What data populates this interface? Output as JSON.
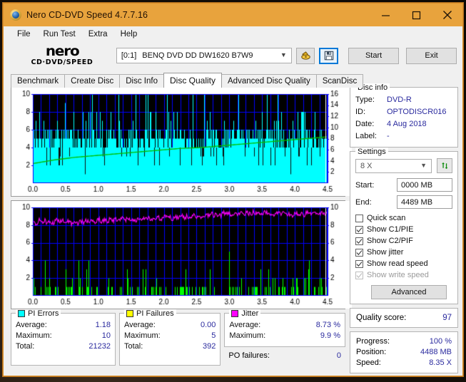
{
  "window": {
    "title": "Nero CD-DVD Speed 4.7.7.16",
    "icon": "nero-disc-icon",
    "minimize": "minimize-icon",
    "maximize": "maximize-icon",
    "close": "close-icon",
    "titlebar_color": "#e8a33d"
  },
  "menu": [
    "File",
    "Run Test",
    "Extra",
    "Help"
  ],
  "logo": {
    "line1": "nero",
    "line2": "CD·DVD∕SPEED"
  },
  "toolbar": {
    "drive_id": "[0:1]",
    "drive_name": "BENQ DVD DD DW1620 B7W9",
    "eject_icon": "eject-disc-icon",
    "save_icon": "save-floppy-icon",
    "start_label": "Start",
    "exit_label": "Exit"
  },
  "tabs": [
    {
      "label": "Benchmark",
      "active": false
    },
    {
      "label": "Create Disc",
      "active": false
    },
    {
      "label": "Disc Info",
      "active": false
    },
    {
      "label": "Disc Quality",
      "active": true
    },
    {
      "label": "Advanced Disc Quality",
      "active": false
    },
    {
      "label": "ScanDisc",
      "active": false
    }
  ],
  "disc_info": {
    "legend": "Disc info",
    "rows": [
      {
        "key": "Type:",
        "value": "DVD-R"
      },
      {
        "key": "ID:",
        "value": "OPTODISCR016"
      },
      {
        "key": "Date:",
        "value": "4 Aug 2018"
      },
      {
        "key": "Label:",
        "value": "-"
      }
    ]
  },
  "settings": {
    "legend": "Settings",
    "speed": "8 X",
    "refresh_icon": "refresh-arrows-icon",
    "start_label": "Start:",
    "start_value": "0000 MB",
    "end_label": "End:",
    "end_value": "4489 MB",
    "checkboxes": [
      {
        "label": "Quick scan",
        "checked": false,
        "disabled": false
      },
      {
        "label": "Show C1/PIE",
        "checked": true,
        "disabled": false
      },
      {
        "label": "Show C2/PIF",
        "checked": true,
        "disabled": false
      },
      {
        "label": "Show jitter",
        "checked": true,
        "disabled": false
      },
      {
        "label": "Show read speed",
        "checked": true,
        "disabled": false
      },
      {
        "label": "Show write speed",
        "checked": true,
        "disabled": true
      }
    ],
    "advanced_label": "Advanced"
  },
  "quality": {
    "label": "Quality score:",
    "value": "97"
  },
  "progress": {
    "rows": [
      {
        "key": "Progress:",
        "value": "100 %"
      },
      {
        "key": "Position:",
        "value": "4488 MB"
      },
      {
        "key": "Speed:",
        "value": "8.35 X"
      }
    ]
  },
  "stats": {
    "pi_errors": {
      "legend": "PI Errors",
      "swatch": "#00ffff",
      "rows": [
        {
          "key": "Average:",
          "value": "1.18"
        },
        {
          "key": "Maximum:",
          "value": "10"
        },
        {
          "key": "Total:",
          "value": "21232"
        }
      ]
    },
    "pi_failures": {
      "legend": "PI Failures",
      "swatch": "#ffff00",
      "rows": [
        {
          "key": "Average:",
          "value": "0.00"
        },
        {
          "key": "Maximum:",
          "value": "5"
        },
        {
          "key": "Total:",
          "value": "392"
        }
      ]
    },
    "jitter": {
      "legend": "Jitter",
      "swatch": "#ff00ff",
      "rows": [
        {
          "key": "Average:",
          "value": "8.73 %"
        },
        {
          "key": "Maximum:",
          "value": "9.9 %"
        }
      ],
      "po_key": "PO failures:",
      "po_value": "0"
    }
  },
  "chart_data": [
    {
      "type": "area",
      "name": "pie-read-speed-graph",
      "title": "PI Errors / Read speed",
      "xlabel": "",
      "ylabel": "",
      "xlim": [
        0.0,
        4.5
      ],
      "ylim": [
        0,
        10
      ],
      "y2lim": [
        0,
        16
      ],
      "grid": true,
      "background": "#000000",
      "gridcolor": "#0000ff",
      "xticks": [
        "0.0",
        "0.5",
        "1.0",
        "1.5",
        "2.0",
        "2.5",
        "3.0",
        "3.5",
        "4.0",
        "4.5"
      ],
      "yticks": [
        "2",
        "4",
        "6",
        "8",
        "10"
      ],
      "y2ticks": [
        "2",
        "4",
        "6",
        "8",
        "10",
        "12",
        "14",
        "16"
      ],
      "series": [
        {
          "name": "PI Errors",
          "color": "#00ffff",
          "style": "area-spikes",
          "baseline": 4,
          "values": [
            8,
            6,
            5,
            4,
            6,
            4,
            5,
            7,
            4,
            6,
            5,
            4,
            8,
            4,
            5,
            6,
            4,
            5,
            4,
            6,
            7,
            5,
            4,
            6,
            5,
            4,
            10,
            6,
            5,
            4,
            5,
            6,
            4,
            5,
            7,
            4,
            6,
            5,
            4,
            5,
            6,
            4,
            8,
            5,
            4,
            6,
            5,
            7,
            4,
            5,
            6,
            4,
            5,
            4,
            6,
            5,
            4,
            5,
            6,
            4,
            8,
            5,
            4,
            6,
            7,
            4,
            5,
            6,
            4,
            5,
            4,
            6,
            5,
            4,
            5,
            6,
            4,
            7,
            5,
            4,
            6,
            5,
            4,
            5,
            6,
            4,
            5,
            4,
            6,
            5,
            4,
            5,
            6,
            4,
            8,
            5,
            4,
            6,
            5,
            4,
            7,
            5,
            4,
            6,
            5,
            4,
            5,
            6,
            4,
            5,
            4,
            6,
            5,
            4,
            9,
            6,
            5,
            4,
            5,
            6,
            4,
            5,
            7,
            4,
            6,
            5,
            4,
            5,
            6,
            4,
            5,
            4,
            6,
            7,
            5,
            4,
            6,
            5,
            4,
            5,
            6,
            4,
            5,
            7,
            4,
            6,
            5,
            4,
            5,
            6,
            5,
            4,
            6,
            5,
            4,
            5,
            6,
            4,
            7,
            5,
            4,
            6,
            5,
            4,
            5,
            6,
            5,
            4,
            6,
            5,
            4,
            6,
            5,
            4,
            5,
            6,
            5,
            4,
            6,
            7,
            5,
            4,
            6,
            5,
            4,
            5
          ]
        },
        {
          "name": "Read speed",
          "color": "#00c000",
          "style": "line",
          "axis": "y2",
          "start_value": 3.5,
          "end_value": 8.35,
          "values_left_scale": [
            2.2,
            2.6,
            2.9,
            3.1,
            3.3,
            3.5,
            3.7,
            3.9,
            4.0,
            4.2,
            4.4,
            4.6,
            4.8,
            5.0,
            5.2
          ]
        }
      ]
    },
    {
      "type": "line",
      "name": "pif-jitter-graph",
      "title": "PI Failures / Jitter",
      "xlabel": "",
      "ylabel": "",
      "xlim": [
        0.0,
        4.5
      ],
      "ylim": [
        0,
        10
      ],
      "y2lim": [
        0,
        10
      ],
      "grid": true,
      "background": "#000000",
      "gridcolor": "#0000ff",
      "xticks": [
        "0.0",
        "0.5",
        "1.0",
        "1.5",
        "2.0",
        "2.5",
        "3.0",
        "3.5",
        "4.0",
        "4.5"
      ],
      "yticks": [
        "2",
        "4",
        "6",
        "8",
        "10"
      ],
      "y2ticks": [
        "2",
        "4",
        "6",
        "8",
        "10"
      ],
      "series": [
        {
          "name": "Jitter",
          "color": "#ff00ff",
          "style": "line",
          "range": [
            8.0,
            9.9
          ],
          "values": [
            8.3,
            8.1,
            8.6,
            8.3,
            8.5,
            8.2,
            8.4,
            8.2,
            8.6,
            8.3,
            8.5,
            8.2,
            8.4,
            8.1,
            8.3,
            8.2,
            8.5,
            8.3,
            8.6,
            8.4,
            8.5,
            8.3,
            8.7,
            8.4,
            8.6,
            8.4,
            8.7,
            8.5,
            8.6,
            8.4,
            8.7,
            8.5,
            8.8,
            8.6,
            8.7,
            8.5,
            8.8,
            8.6,
            8.9,
            8.7,
            8.8,
            8.6,
            8.9,
            8.7,
            9.0,
            8.8,
            8.9,
            8.7,
            9.0,
            8.8,
            9.1,
            8.9,
            9.0,
            8.8,
            9.2,
            9.0,
            9.1,
            8.9,
            9.2,
            9.0,
            9.3,
            9.1,
            9.2,
            9.0,
            9.4,
            9.2,
            9.3,
            9.1,
            9.4,
            9.2,
            9.5,
            9.3,
            9.4,
            9.2,
            9.5,
            9.3,
            9.4,
            9.2,
            9.5,
            9.3,
            9.4,
            9.2,
            9.5,
            9.3,
            9.4,
            9.2,
            9.3,
            9.1,
            9.4,
            9.2,
            9.3,
            9.1,
            9.4,
            9.2,
            9.3,
            9.5,
            9.3,
            9.4,
            9.2,
            9.7
          ]
        },
        {
          "name": "PI Failures",
          "color": "#00ff00",
          "style": "bars",
          "max": 5,
          "values": [
            2,
            0,
            1,
            0,
            0,
            1,
            0,
            0,
            3,
            2,
            3,
            0,
            1,
            2,
            1,
            2,
            1,
            0,
            0,
            4,
            1,
            0,
            1,
            0,
            2,
            1,
            4,
            2,
            0,
            1,
            0,
            3,
            1,
            0,
            0,
            0,
            1,
            1,
            0,
            0,
            1,
            0,
            1,
            0,
            0,
            0,
            1,
            0,
            2,
            0,
            1,
            1,
            0,
            1,
            1,
            0,
            0,
            1,
            0,
            0,
            0,
            1,
            0,
            3,
            1,
            0,
            1,
            0,
            0,
            0,
            1,
            0,
            1,
            1,
            0,
            0,
            0,
            1,
            0,
            0,
            3,
            0,
            1,
            0,
            0,
            0,
            1,
            0,
            0,
            5,
            1,
            0,
            1,
            0,
            0,
            4,
            1,
            0,
            1,
            1,
            2,
            1,
            0,
            1,
            1,
            0,
            5,
            3,
            2,
            1,
            0,
            1,
            0,
            1,
            0,
            0,
            1,
            0,
            3,
            1,
            0,
            1,
            0,
            0,
            1,
            0,
            3,
            2,
            1,
            0,
            1,
            1,
            0,
            1,
            1,
            0,
            0,
            1,
            0,
            2,
            0,
            2,
            1,
            0,
            1,
            0,
            2,
            0,
            0,
            1,
            0,
            0,
            1,
            0,
            0,
            0
          ]
        }
      ]
    }
  ]
}
